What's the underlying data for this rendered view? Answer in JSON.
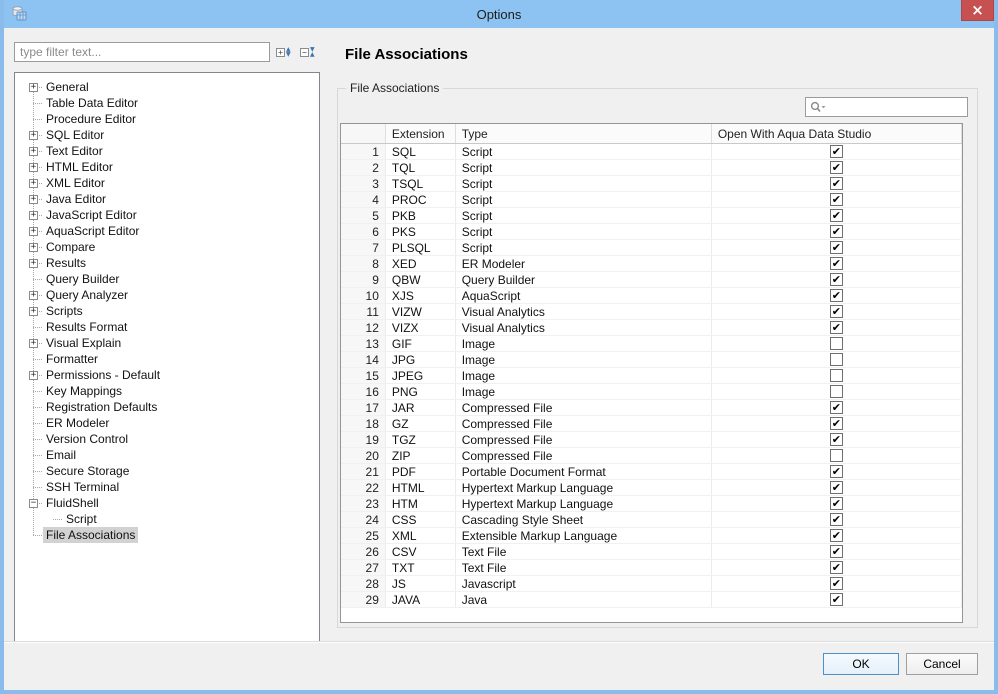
{
  "window": {
    "title": "Options"
  },
  "colors": {
    "titlebar": "#8dc3f2",
    "window_border": "#89bcea",
    "close_button": "#c75050",
    "ok_border": "#4d90c8",
    "tree_selection": "#d2d2d2"
  },
  "icons": {
    "app": "database-table-icon",
    "close": "close-icon",
    "expand_all": "expand-all-icon",
    "collapse_all": "collapse-all-icon",
    "search": "search-dropdown-icon"
  },
  "sidebar": {
    "filter_placeholder": "type filter text...",
    "tree": [
      {
        "label": "General",
        "expand": "+"
      },
      {
        "label": "Table Data Editor",
        "expand": ""
      },
      {
        "label": "Procedure Editor",
        "expand": ""
      },
      {
        "label": "SQL Editor",
        "expand": "+"
      },
      {
        "label": "Text Editor",
        "expand": "+"
      },
      {
        "label": "HTML Editor",
        "expand": "+"
      },
      {
        "label": "XML Editor",
        "expand": "+"
      },
      {
        "label": "Java Editor",
        "expand": "+"
      },
      {
        "label": "JavaScript Editor",
        "expand": "+"
      },
      {
        "label": "AquaScript Editor",
        "expand": "+"
      },
      {
        "label": "Compare",
        "expand": "+"
      },
      {
        "label": "Results",
        "expand": "+"
      },
      {
        "label": "Query Builder",
        "expand": ""
      },
      {
        "label": "Query Analyzer",
        "expand": "+"
      },
      {
        "label": "Scripts",
        "expand": "+"
      },
      {
        "label": "Results Format",
        "expand": ""
      },
      {
        "label": "Visual Explain",
        "expand": "+"
      },
      {
        "label": "Formatter",
        "expand": ""
      },
      {
        "label": "Permissions - Default",
        "expand": "+"
      },
      {
        "label": "Key Mappings",
        "expand": ""
      },
      {
        "label": "Registration Defaults",
        "expand": ""
      },
      {
        "label": "ER Modeler",
        "expand": ""
      },
      {
        "label": "Version Control",
        "expand": ""
      },
      {
        "label": "Email",
        "expand": ""
      },
      {
        "label": "Secure Storage",
        "expand": ""
      },
      {
        "label": "SSH Terminal",
        "expand": ""
      },
      {
        "label": "FluidShell",
        "expand": "-"
      },
      {
        "label": "Script",
        "expand": "",
        "child": true
      },
      {
        "label": "File Associations",
        "expand": "",
        "selected": true
      }
    ]
  },
  "main": {
    "heading": "File Associations",
    "group_label": "File Associations",
    "search_value": "",
    "table": {
      "columns": [
        "",
        "Extension",
        "Type",
        "Open With Aqua Data Studio"
      ],
      "rows": [
        {
          "n": 1,
          "ext": "SQL",
          "type": "Script",
          "open": true
        },
        {
          "n": 2,
          "ext": "TQL",
          "type": "Script",
          "open": true
        },
        {
          "n": 3,
          "ext": "TSQL",
          "type": "Script",
          "open": true
        },
        {
          "n": 4,
          "ext": "PROC",
          "type": "Script",
          "open": true
        },
        {
          "n": 5,
          "ext": "PKB",
          "type": "Script",
          "open": true
        },
        {
          "n": 6,
          "ext": "PKS",
          "type": "Script",
          "open": true
        },
        {
          "n": 7,
          "ext": "PLSQL",
          "type": "Script",
          "open": true
        },
        {
          "n": 8,
          "ext": "XED",
          "type": "ER Modeler",
          "open": true
        },
        {
          "n": 9,
          "ext": "QBW",
          "type": "Query Builder",
          "open": true
        },
        {
          "n": 10,
          "ext": "XJS",
          "type": "AquaScript",
          "open": true
        },
        {
          "n": 11,
          "ext": "VIZW",
          "type": "Visual Analytics",
          "open": true
        },
        {
          "n": 12,
          "ext": "VIZX",
          "type": "Visual Analytics",
          "open": true
        },
        {
          "n": 13,
          "ext": "GIF",
          "type": "Image",
          "open": false
        },
        {
          "n": 14,
          "ext": "JPG",
          "type": "Image",
          "open": false
        },
        {
          "n": 15,
          "ext": "JPEG",
          "type": "Image",
          "open": false
        },
        {
          "n": 16,
          "ext": "PNG",
          "type": "Image",
          "open": false
        },
        {
          "n": 17,
          "ext": "JAR",
          "type": "Compressed File",
          "open": true
        },
        {
          "n": 18,
          "ext": "GZ",
          "type": "Compressed File",
          "open": true
        },
        {
          "n": 19,
          "ext": "TGZ",
          "type": "Compressed File",
          "open": true
        },
        {
          "n": 20,
          "ext": "ZIP",
          "type": "Compressed File",
          "open": false
        },
        {
          "n": 21,
          "ext": "PDF",
          "type": "Portable Document Format",
          "open": true
        },
        {
          "n": 22,
          "ext": "HTML",
          "type": "Hypertext Markup Language",
          "open": true
        },
        {
          "n": 23,
          "ext": "HTM",
          "type": "Hypertext Markup Language",
          "open": true
        },
        {
          "n": 24,
          "ext": "CSS",
          "type": "Cascading Style Sheet",
          "open": true
        },
        {
          "n": 25,
          "ext": "XML",
          "type": "Extensible Markup Language",
          "open": true
        },
        {
          "n": 26,
          "ext": "CSV",
          "type": "Text File",
          "open": true
        },
        {
          "n": 27,
          "ext": "TXT",
          "type": "Text File",
          "open": true
        },
        {
          "n": 28,
          "ext": "JS",
          "type": "Javascript",
          "open": true
        },
        {
          "n": 29,
          "ext": "JAVA",
          "type": "Java",
          "open": true
        }
      ]
    }
  },
  "footer": {
    "ok_label": "OK",
    "cancel_label": "Cancel"
  }
}
